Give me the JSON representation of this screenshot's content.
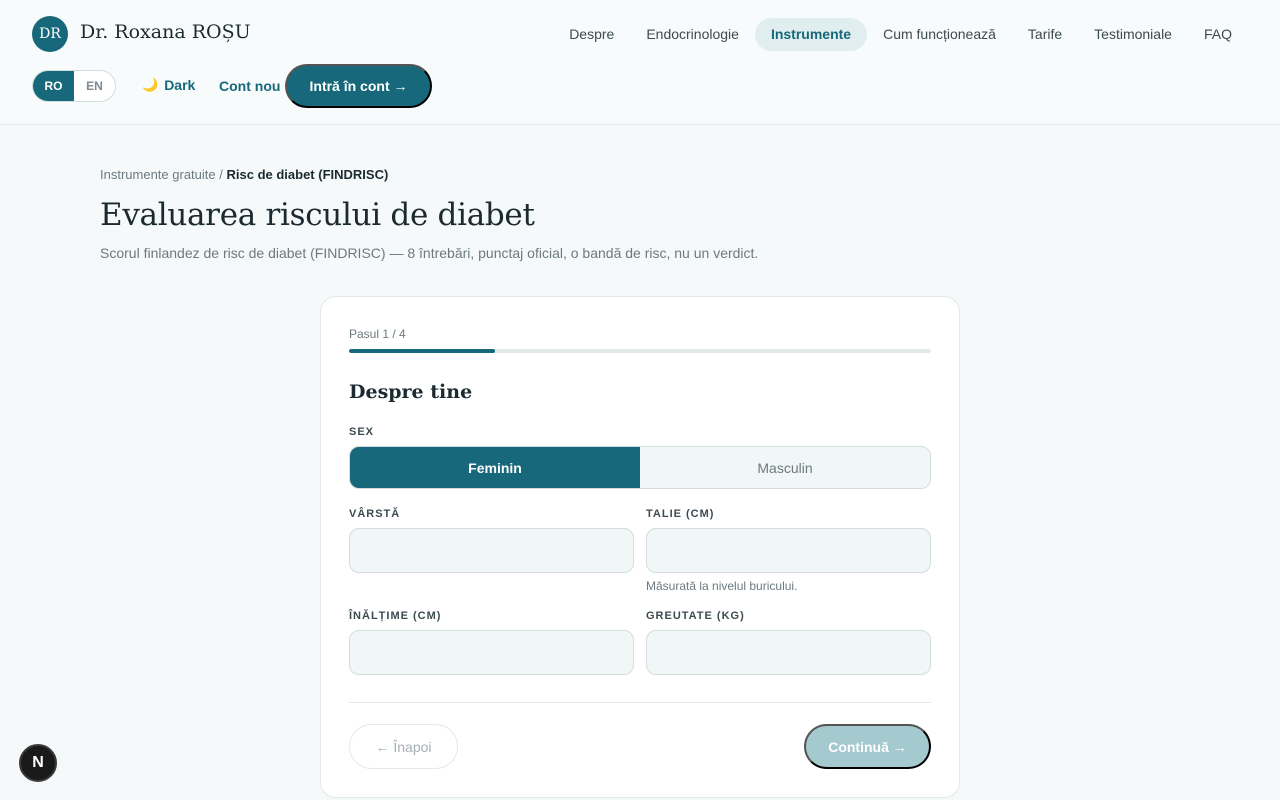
{
  "brand": {
    "initials": "DR",
    "name": "Dr. Roxana ROȘU"
  },
  "nav": {
    "items": [
      {
        "label": "Despre"
      },
      {
        "label": "Endocrinologie"
      },
      {
        "label": "Instrumente",
        "active": true
      },
      {
        "label": "Cum funcționează"
      },
      {
        "label": "Tarife"
      },
      {
        "label": "Testimoniale"
      },
      {
        "label": "FAQ"
      }
    ]
  },
  "header": {
    "lang": {
      "ro": "RO",
      "en": "EN",
      "selected": "RO"
    },
    "dark_label": "Dark",
    "moon_icon": "moon-icon",
    "signup_label": "Cont nou",
    "login_label": "Intră în cont →"
  },
  "breadcrumb": {
    "parent": "Instrumente gratuite",
    "separator": "/",
    "current": "Risc de diabet (FINDRISC)"
  },
  "page": {
    "title": "Evaluarea riscului de diabet",
    "subtitle": "Scorul finlandez de risc de diabet (FINDRISC) — 8 întrebări, punctaj oficial, o bandă de risc, nu un verdict."
  },
  "form": {
    "step_label": "Pasul 1 / 4",
    "progress_fraction": 0.25,
    "section_title": "Despre tine",
    "sex": {
      "label": "SEX",
      "options": [
        "Feminin",
        "Masculin"
      ],
      "selected": "Feminin"
    },
    "age": {
      "label": "VÂRSTĂ",
      "value": "",
      "placeholder": ""
    },
    "waist": {
      "label": "TALIE (CM)",
      "value": "",
      "placeholder": "",
      "hint": "Măsurată la nivelul buricului."
    },
    "height": {
      "label": "ÎNĂLȚIME (CM)",
      "value": "",
      "placeholder": ""
    },
    "weight": {
      "label": "GREUTATE (KG)",
      "value": "",
      "placeholder": ""
    },
    "back_label": "← Înapoi",
    "continue_label": "Continuă →"
  },
  "dev_badge": {
    "letter": "N"
  },
  "colors": {
    "primary": "#16687a",
    "primary_disabled": "#a4c9cf",
    "background": "#f6f9f9"
  }
}
